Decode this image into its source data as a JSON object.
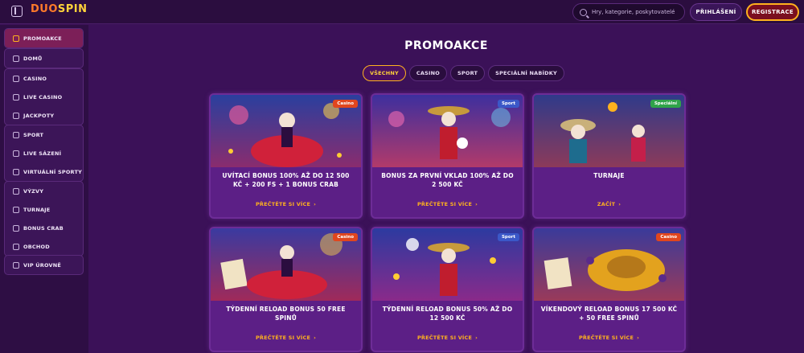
{
  "header": {
    "logo_part1": "DUO",
    "logo_part2": "SPIN",
    "search_placeholder": "Hry, kategorie, poskytovatelé",
    "login_label": "PŘIHLÁŠENÍ",
    "register_label": "REGISTRACE"
  },
  "sidebar": {
    "items": [
      {
        "label": "PROMOAKCE",
        "icon": "gift-icon",
        "active": true
      },
      {
        "label": "DOMŮ",
        "icon": "home-icon"
      },
      {
        "label": "CASINO",
        "icon": "slot-machine-icon"
      },
      {
        "label": "LIVE CASINO",
        "icon": "cards-icon"
      },
      {
        "label": "JACKPOTY",
        "icon": "jackpot-icon"
      },
      {
        "label": "SPORT",
        "icon": "ball-icon"
      },
      {
        "label": "LIVE SÁZENÍ",
        "icon": "play-icon"
      },
      {
        "label": "VIRTUÁLNÍ SPORTY",
        "icon": "virtual-icon"
      },
      {
        "label": "VÝZVY",
        "icon": "challenge-icon"
      },
      {
        "label": "TURNAJE",
        "icon": "trophy-icon"
      },
      {
        "label": "BONUS CRAB",
        "icon": "crab-icon"
      },
      {
        "label": "OBCHOD",
        "icon": "shop-icon"
      },
      {
        "label": "VIP ÚROVNĚ",
        "icon": "diamond-icon"
      }
    ]
  },
  "main": {
    "title": "PROMOAKCE",
    "tabs": [
      {
        "label": "VŠECHNY",
        "active": true
      },
      {
        "label": "CASINO"
      },
      {
        "label": "SPORT"
      },
      {
        "label": "SPECIÁLNÍ NABÍDKY"
      }
    ],
    "cards": [
      {
        "badge": "Casino",
        "badge_type": "casino",
        "title": "UVÍTACÍ BONUS 100% AŽ DO 12 500 KČ + 200 FS + 1 BONUS CRAB",
        "link": "PŘEČTĚTE SI VÍCE"
      },
      {
        "badge": "Sport",
        "badge_type": "sport",
        "title": "BONUS ZA PRVNÍ VKLAD 100% AŽ DO 2 500 KČ",
        "link": "PŘEČTĚTE SI VÍCE"
      },
      {
        "badge": "Speciální",
        "badge_type": "special",
        "title": "TURNAJE",
        "link": "ZAČÍT"
      },
      {
        "badge": "Casino",
        "badge_type": "casino",
        "title": "TÝDENNÍ RELOAD BONUS 50 FREE SPINŮ",
        "link": "PŘEČTĚTE SI VÍCE"
      },
      {
        "badge": "Sport",
        "badge_type": "sport",
        "title": "TÝDENNÍ RELOAD BONUS 50% AŽ DO 12 500 KČ",
        "link": "PŘEČTĚTE SI VÍCE"
      },
      {
        "badge": "Casino",
        "badge_type": "casino",
        "title": "VÍKENDOVÝ RELOAD BONUS 17 500 KČ + 50 FREE SPINŮ",
        "link": "PŘEČTĚTE SI VÍCE"
      }
    ]
  },
  "colors": {
    "accent": "#ffb21e",
    "background": "#3b1158",
    "card": "#5c1f86"
  }
}
